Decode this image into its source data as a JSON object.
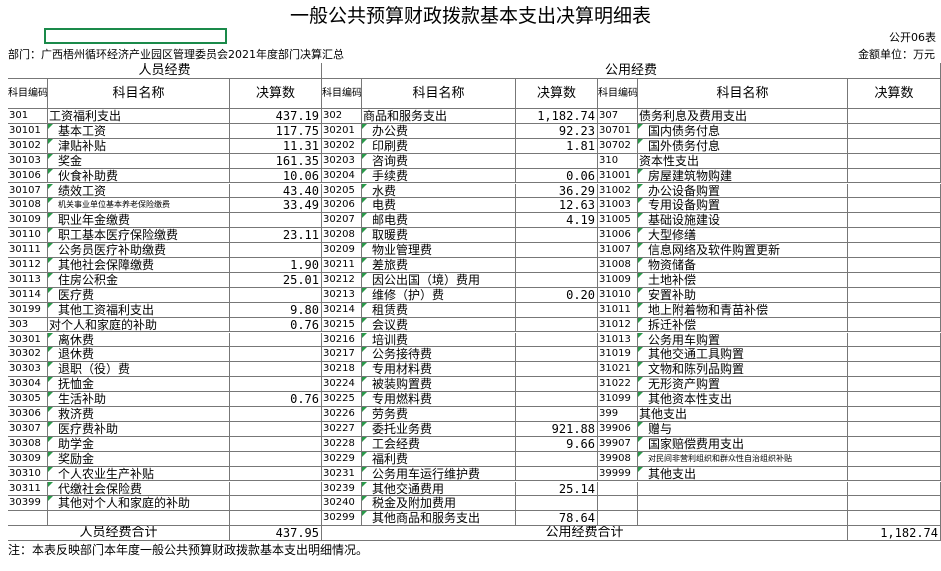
{
  "title": "一般公共预算财政拨款基本支出决算明细表",
  "form_code": "公开06表",
  "dept_line": "部门：广西梧州循环经济产业园区管理委员会2021年度部门决算汇总",
  "unit_line": "金额单位：万元",
  "headers": {
    "personnel": "人员经费",
    "public": "公用经费",
    "code": "科目编码",
    "name": "科目名称",
    "amount": "决算数"
  },
  "personnel": [
    {
      "code": "301",
      "name": "工资福利支出",
      "amount": "437.19",
      "top": true
    },
    {
      "code": "30101",
      "name": "基本工资",
      "amount": "117.75"
    },
    {
      "code": "30102",
      "name": "津贴补贴",
      "amount": "11.31"
    },
    {
      "code": "30103",
      "name": "奖金",
      "amount": "161.35"
    },
    {
      "code": "30106",
      "name": "伙食补助费",
      "amount": "10.06"
    },
    {
      "code": "30107",
      "name": "绩效工资",
      "amount": "43.40"
    },
    {
      "code": "30108",
      "name": "机关事业单位基本养老保险缴费",
      "amount": "33.49",
      "small": true
    },
    {
      "code": "30109",
      "name": "职业年金缴费",
      "amount": ""
    },
    {
      "code": "30110",
      "name": "职工基本医疗保险缴费",
      "amount": "23.11"
    },
    {
      "code": "30111",
      "name": "公务员医疗补助缴费",
      "amount": ""
    },
    {
      "code": "30112",
      "name": "其他社会保障缴费",
      "amount": "1.90"
    },
    {
      "code": "30113",
      "name": "住房公积金",
      "amount": "25.01"
    },
    {
      "code": "30114",
      "name": "医疗费",
      "amount": ""
    },
    {
      "code": "30199",
      "name": "其他工资福利支出",
      "amount": "9.80"
    },
    {
      "code": "303",
      "name": "对个人和家庭的补助",
      "amount": "0.76",
      "top": true
    },
    {
      "code": "30301",
      "name": "离休费",
      "amount": ""
    },
    {
      "code": "30302",
      "name": "退休费",
      "amount": ""
    },
    {
      "code": "30303",
      "name": "退职（役）费",
      "amount": ""
    },
    {
      "code": "30304",
      "name": "抚恤金",
      "amount": ""
    },
    {
      "code": "30305",
      "name": "生活补助",
      "amount": "0.76"
    },
    {
      "code": "30306",
      "name": "救济费",
      "amount": ""
    },
    {
      "code": "30307",
      "name": "医疗费补助",
      "amount": ""
    },
    {
      "code": "30308",
      "name": "助学金",
      "amount": ""
    },
    {
      "code": "30309",
      "name": "奖励金",
      "amount": ""
    },
    {
      "code": "30310",
      "name": "个人农业生产补贴",
      "amount": ""
    },
    {
      "code": "30311",
      "name": "代缴社会保险费",
      "amount": ""
    },
    {
      "code": "30399",
      "name": "其他对个人和家庭的补助",
      "amount": ""
    }
  ],
  "public_a": [
    {
      "code": "302",
      "name": "商品和服务支出",
      "amount": "1,182.74",
      "top": true
    },
    {
      "code": "30201",
      "name": "办公费",
      "amount": "92.23"
    },
    {
      "code": "30202",
      "name": "印刷费",
      "amount": "1.81"
    },
    {
      "code": "30203",
      "name": "咨询费",
      "amount": ""
    },
    {
      "code": "30204",
      "name": "手续费",
      "amount": "0.06"
    },
    {
      "code": "30205",
      "name": "水费",
      "amount": "36.29"
    },
    {
      "code": "30206",
      "name": "电费",
      "amount": "12.63"
    },
    {
      "code": "30207",
      "name": "邮电费",
      "amount": "4.19"
    },
    {
      "code": "30208",
      "name": "取暖费",
      "amount": ""
    },
    {
      "code": "30209",
      "name": "物业管理费",
      "amount": ""
    },
    {
      "code": "30211",
      "name": "差旅费",
      "amount": ""
    },
    {
      "code": "30212",
      "name": "因公出国（境）费用",
      "amount": ""
    },
    {
      "code": "30213",
      "name": "维修（护）费",
      "amount": "0.20"
    },
    {
      "code": "30214",
      "name": "租赁费",
      "amount": ""
    },
    {
      "code": "30215",
      "name": "会议费",
      "amount": ""
    },
    {
      "code": "30216",
      "name": "培训费",
      "amount": ""
    },
    {
      "code": "30217",
      "name": "公务接待费",
      "amount": ""
    },
    {
      "code": "30218",
      "name": "专用材料费",
      "amount": ""
    },
    {
      "code": "30224",
      "name": "被装购置费",
      "amount": ""
    },
    {
      "code": "30225",
      "name": "专用燃料费",
      "amount": ""
    },
    {
      "code": "30226",
      "name": "劳务费",
      "amount": ""
    },
    {
      "code": "30227",
      "name": "委托业务费",
      "amount": "921.88"
    },
    {
      "code": "30228",
      "name": "工会经费",
      "amount": "9.66"
    },
    {
      "code": "30229",
      "name": "福利费",
      "amount": ""
    },
    {
      "code": "30231",
      "name": "公务用车运行维护费",
      "amount": ""
    },
    {
      "code": "30239",
      "name": "其他交通费用",
      "amount": "25.14"
    },
    {
      "code": "30240",
      "name": "税金及附加费用",
      "amount": ""
    },
    {
      "code": "30299",
      "name": "其他商品和服务支出",
      "amount": "78.64"
    }
  ],
  "public_b": [
    {
      "code": "307",
      "name": "债务利息及费用支出",
      "amount": "",
      "top": true
    },
    {
      "code": "30701",
      "name": "国内债务付息",
      "amount": ""
    },
    {
      "code": "30702",
      "name": "国外债务付息",
      "amount": ""
    },
    {
      "code": "310",
      "name": "资本性支出",
      "amount": "",
      "top": true
    },
    {
      "code": "31001",
      "name": "房屋建筑物购建",
      "amount": ""
    },
    {
      "code": "31002",
      "name": "办公设备购置",
      "amount": ""
    },
    {
      "code": "31003",
      "name": "专用设备购置",
      "amount": ""
    },
    {
      "code": "31005",
      "name": "基础设施建设",
      "amount": ""
    },
    {
      "code": "31006",
      "name": "大型修缮",
      "amount": ""
    },
    {
      "code": "31007",
      "name": "信息网络及软件购置更新",
      "amount": ""
    },
    {
      "code": "31008",
      "name": "物资储备",
      "amount": ""
    },
    {
      "code": "31009",
      "name": "土地补偿",
      "amount": ""
    },
    {
      "code": "31010",
      "name": "安置补助",
      "amount": ""
    },
    {
      "code": "31011",
      "name": "地上附着物和青苗补偿",
      "amount": ""
    },
    {
      "code": "31012",
      "name": "拆迁补偿",
      "amount": ""
    },
    {
      "code": "31013",
      "name": "公务用车购置",
      "amount": ""
    },
    {
      "code": "31019",
      "name": "其他交通工具购置",
      "amount": ""
    },
    {
      "code": "31021",
      "name": "文物和陈列品购置",
      "amount": ""
    },
    {
      "code": "31022",
      "name": "无形资产购置",
      "amount": ""
    },
    {
      "code": "31099",
      "name": "其他资本性支出",
      "amount": ""
    },
    {
      "code": "399",
      "name": "其他支出",
      "amount": "",
      "top": true
    },
    {
      "code": "39906",
      "name": "赠与",
      "amount": ""
    },
    {
      "code": "39907",
      "name": "国家赔偿费用支出",
      "amount": ""
    },
    {
      "code": "39908",
      "name": "对民间非营利组织和群众性自治组织补贴",
      "amount": "",
      "small": true
    },
    {
      "code": "39999",
      "name": "其他支出",
      "amount": ""
    }
  ],
  "totals": {
    "personnel_label": "人员经费合计",
    "personnel_amount": "437.95",
    "public_label": "公用经费合计",
    "public_amount": "1,182.74"
  },
  "footnote": "注：本表反映部门本年度一般公共预算财政拨款基本支出明细情况。"
}
